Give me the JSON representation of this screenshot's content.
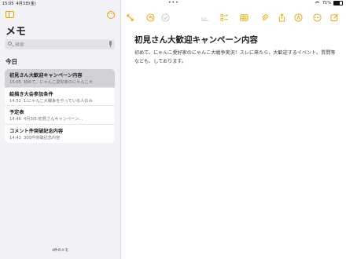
{
  "status": {
    "time": "15:05",
    "date": "4月3日(金)",
    "battery": "71%",
    "battery_level": 0.71
  },
  "sidebar": {
    "folder_title": "メモ",
    "search_placeholder": "検索",
    "section": "今日",
    "notes": [
      {
        "title": "初見さん大歓迎キャンペーン内容",
        "time": "15:05",
        "preview": "初めて、にゃんこ愛好家のにゃんこ大",
        "selected": true
      },
      {
        "title": "絵描き大会参加条件",
        "time": "14:52",
        "preview": "1.にゃんこ大戦争をやっている人のみ"
      },
      {
        "title": "予定表",
        "time": "14:46",
        "preview": "4月3日:初見さんキャンペーン..."
      },
      {
        "title": "コメント件突破記念内容",
        "time": "14:43",
        "preview": "300件突破記念内容"
      }
    ],
    "footer": "4件のメモ"
  },
  "toolbar": {
    "icons": [
      "collapse-icon",
      "undo-icon",
      "checkmark-circle-icon",
      "text-format-icon",
      "checklist-icon",
      "table-icon",
      "attachment-icon",
      "share-icon",
      "markup-icon",
      "compose-icon",
      "more-icon",
      "compose-new-icon"
    ],
    "accent": "#e6a700"
  },
  "note": {
    "heading": "初見さん大歓迎キャンペーン内容",
    "body": "初めて、にゃんこ愛好家のにゃんこ大戦争実況！スレに来たら、大歓迎するイベント。質問等なども、しております。"
  }
}
